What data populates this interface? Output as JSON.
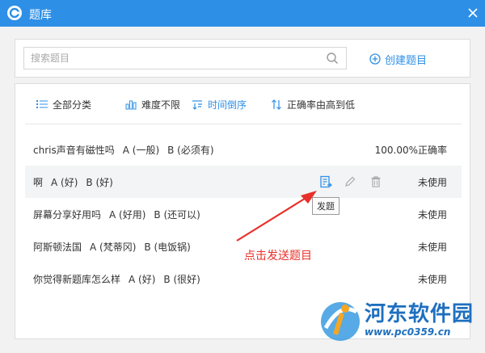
{
  "window": {
    "title": "题库",
    "logo_icon": "chat-logo-icon",
    "accent": "#2e8fe6"
  },
  "search": {
    "placeholder": "搜索题目",
    "value": ""
  },
  "toolbar": {
    "create_label": "创建题目"
  },
  "filters": [
    {
      "label": "全部分类",
      "icon": "list-icon"
    },
    {
      "label": "难度不限",
      "icon": "bar-chart-icon"
    },
    {
      "label": "时间倒序",
      "icon": "sort-time-icon"
    },
    {
      "label": "正确率由高到低",
      "icon": "sort-arrows-icon"
    }
  ],
  "questions": [
    {
      "title": "chris声音有磁性吗",
      "options": [
        "A (一般)",
        "B (必须有)"
      ],
      "status": "100.00%正确率"
    },
    {
      "title": "啊",
      "options": [
        "A (好)",
        "B (好)"
      ],
      "status": "未使用"
    },
    {
      "title": "屏幕分享好用吗",
      "options": [
        "A (好用)",
        "B (还可以)"
      ],
      "status": "未使用"
    },
    {
      "title": "阿斯顿法国",
      "options": [
        "A (梵蒂冈)",
        "B (电饭锅)"
      ],
      "status": "未使用"
    },
    {
      "title": "你觉得新题库怎么样",
      "options": [
        "A (好)",
        "B (很好)"
      ],
      "status": "未使用"
    }
  ],
  "row_tools": {
    "send_icon": "send-question-icon",
    "edit_icon": "pencil-icon",
    "delete_icon": "trash-icon",
    "tooltip": "发题"
  },
  "annotation": {
    "text": "点击发送题目",
    "color": "#e8302a"
  },
  "watermark": {
    "name": "河东软件园",
    "url": "www.pc0359.cn"
  }
}
